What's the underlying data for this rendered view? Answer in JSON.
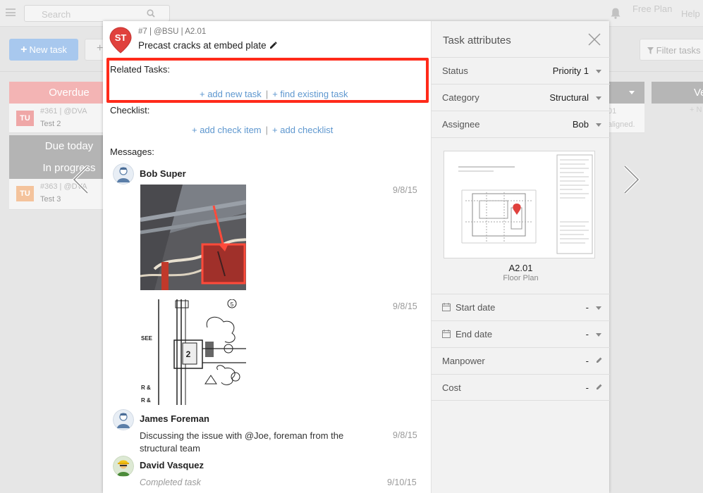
{
  "topbar": {
    "search_placeholder": "Search",
    "free_plan": "Free Plan",
    "help": "Help"
  },
  "toolbar": {
    "new_task": "New task",
    "filter_tasks": "Filter tasks"
  },
  "board": {
    "columns": [
      {
        "title": "Overdue",
        "color": "#f3b4b4"
      },
      {
        "title": "Due today",
        "color": "#b4b4b4"
      },
      {
        "title": "In progress",
        "color": "#b4b4b4"
      },
      {
        "title": "Ve",
        "color": "#b6b6b6"
      }
    ],
    "cards": [
      {
        "initials": "TU",
        "meta": "#361 | @DVA",
        "title": "Test 2",
        "color": "#efa7a7"
      },
      {
        "initials": "TU",
        "meta": "#363 | @DVA",
        "title": "Test 3",
        "color": "#f4c39c"
      }
    ],
    "right_card_meta": "01",
    "right_card_text": "aligned.",
    "add_new_short": "+ N"
  },
  "task": {
    "pin_initials": "ST",
    "pin_color": "#e0413d",
    "meta": "#7 | @BSU | A2.01",
    "title": "Precast cracks at embed plate"
  },
  "related": {
    "label": "Related Tasks:",
    "add_new": "+ add new task",
    "find_existing": "+ find existing task",
    "separator": "|"
  },
  "checklist": {
    "label": "Checklist:",
    "add_item": "+ add check item",
    "add_list": "+ add checklist",
    "separator": "|"
  },
  "messages": {
    "label": "Messages:",
    "items": [
      {
        "author": "Bob Super",
        "date": "9/8/15"
      },
      {
        "date": "9/8/15"
      },
      {
        "author": "James Foreman",
        "text": "Discussing the issue with @Joe, foreman from the structural team",
        "date": "9/8/15"
      },
      {
        "author": "David Vasquez",
        "text": "Completed task",
        "date": "9/10/15"
      }
    ],
    "drawing_text": [
      "SEE",
      "R &",
      "R &"
    ]
  },
  "attributes": {
    "title": "Task attributes",
    "rows": [
      {
        "label": "Status",
        "value": "Priority 1"
      },
      {
        "label": "Category",
        "value": "Structural"
      },
      {
        "label": "Assignee",
        "value": "Bob"
      },
      {
        "label": "Start date",
        "value": "-"
      },
      {
        "label": "End date",
        "value": "-"
      },
      {
        "label": "Manpower",
        "value": "-"
      },
      {
        "label": "Cost",
        "value": "-"
      }
    ],
    "sheet_name": "A2.01",
    "sheet_desc": "Floor Plan"
  },
  "colors": {
    "highlight": "#ff2a1a",
    "link": "#5e97cf",
    "primary_button": "#a8c8ee"
  }
}
